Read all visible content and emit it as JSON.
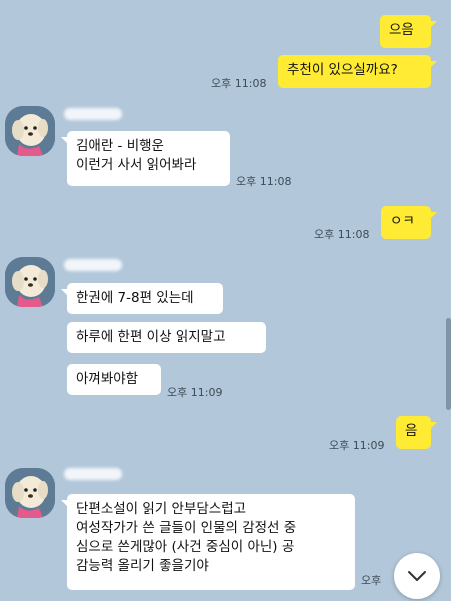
{
  "colors": {
    "background": "#b2c7d9",
    "my_bubble": "#ffeb33",
    "their_bubble": "#ffffff"
  },
  "messages": [
    {
      "text": "으음"
    },
    {
      "text": "추천이 있으실까요?",
      "time": "오후 11:08"
    },
    {
      "text": "김애란 - 비행운\n이런거 사서 읽어봐라",
      "time": "오후 11:08"
    },
    {
      "text": "ㅇㅋ",
      "time": "오후 11:08"
    },
    {
      "text": "한권에 7-8편 있는데"
    },
    {
      "text": "하루에 한편 이상 읽지말고"
    },
    {
      "text": "아껴봐야함",
      "time": "오후 11:09"
    },
    {
      "text": "음",
      "time": "오후 11:09"
    },
    {
      "text": "단편소설이 읽기 안부담스럽고\n여성작가가 쓴 글들이 인물의 감정선 중\n심으로 쓴게많아 (사건 중심이 아닌) 공\n감능력 올리기 좋을기야",
      "time": "오후"
    }
  ],
  "icons": {
    "scroll_down": "chevron-down-icon",
    "avatar": "dog-avatar"
  }
}
